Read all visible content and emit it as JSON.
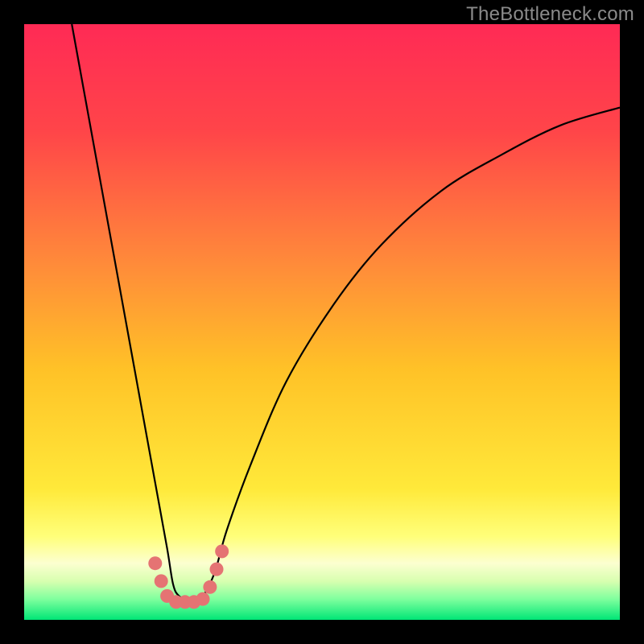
{
  "watermark": "TheBottleneck.com",
  "chart_data": {
    "type": "line",
    "title": "",
    "xlabel": "",
    "ylabel": "",
    "xlim": [
      0,
      100
    ],
    "ylim": [
      0,
      100
    ],
    "background_gradient_stops": [
      {
        "pos": 0.0,
        "color": "#ff2a55"
      },
      {
        "pos": 0.18,
        "color": "#ff4549"
      },
      {
        "pos": 0.4,
        "color": "#ff8a3a"
      },
      {
        "pos": 0.58,
        "color": "#ffc227"
      },
      {
        "pos": 0.78,
        "color": "#ffe93a"
      },
      {
        "pos": 0.86,
        "color": "#ffff7a"
      },
      {
        "pos": 0.905,
        "color": "#fcffd0"
      },
      {
        "pos": 0.935,
        "color": "#d8ffb0"
      },
      {
        "pos": 0.965,
        "color": "#80ff9e"
      },
      {
        "pos": 1.0,
        "color": "#00e676"
      }
    ],
    "series": [
      {
        "name": "bottleneck-curve",
        "color": "#000000",
        "x": [
          8,
          10,
          12,
          14,
          16,
          18,
          20,
          22,
          24,
          25,
          26,
          28,
          30,
          32,
          34,
          38,
          44,
          52,
          60,
          70,
          80,
          90,
          100
        ],
        "y": [
          100,
          89,
          78,
          67,
          56,
          45,
          34,
          23,
          12,
          6,
          4,
          3,
          4,
          8,
          15,
          26,
          40,
          53,
          63,
          72,
          78,
          83,
          86
        ]
      }
    ],
    "markers": {
      "name": "highlight-points",
      "color": "#e57373",
      "points": [
        {
          "x": 22.0,
          "y": 9.5
        },
        {
          "x": 23.0,
          "y": 6.5
        },
        {
          "x": 24.0,
          "y": 4.0
        },
        {
          "x": 25.5,
          "y": 3.0
        },
        {
          "x": 27.0,
          "y": 3.0
        },
        {
          "x": 28.5,
          "y": 3.0
        },
        {
          "x": 30.0,
          "y": 3.5
        },
        {
          "x": 31.2,
          "y": 5.5
        },
        {
          "x": 32.3,
          "y": 8.5
        },
        {
          "x": 33.2,
          "y": 11.5
        }
      ]
    }
  }
}
